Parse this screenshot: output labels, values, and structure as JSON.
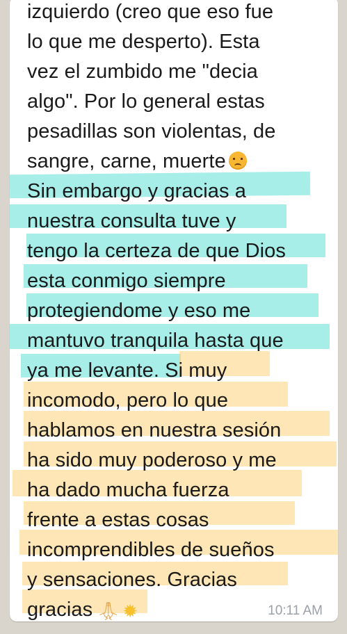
{
  "message": {
    "lines": [
      "izquierdo (creo que eso fue",
      "lo que me desperto). Esta",
      "vez el zumbido me \"decia",
      "algo\". Por lo general estas",
      "pesadillas son violentas, de",
      "sangre, carne, muerte",
      "Sin embargo y gracias a",
      "nuestra consulta tuve y",
      "tengo la certeza de que Dios",
      "esta conmigo siempre",
      "protegiendome y eso me",
      "mantuvo tranquila hasta que",
      "ya me levante. Si muy",
      "incomodo, pero lo que",
      "hablamos en nuestra sesión",
      "ha sido muy poderoso y me",
      "ha dado mucha fuerza",
      "frente a estas cosas",
      "incomprendibles de sueños",
      "y sensaciones. Gracias",
      "gracias"
    ],
    "time": "10:11 AM",
    "emoji": {
      "sad": "disappointed-face-icon",
      "pray": "folded-hands-icon",
      "star": "glowing-star-icon"
    },
    "highlight_colors": {
      "teal": "#5ee0d6",
      "yellow": "#ffd27a"
    }
  }
}
